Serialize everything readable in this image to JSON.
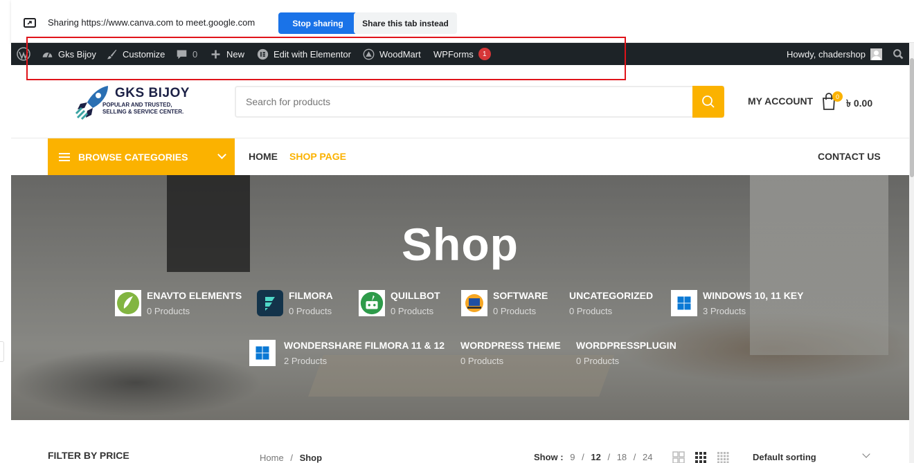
{
  "share_bar": {
    "text": "Sharing https://www.canva.com to meet.google.com",
    "stop_label": "Stop sharing",
    "share_tab_label": "Share this tab instead"
  },
  "admin_bar": {
    "site_name": "Gks Bijoy",
    "customize": "Customize",
    "comments_count": "0",
    "new": "New",
    "elementor": "Edit with Elementor",
    "woodmart": "WoodMart",
    "wpforms": "WPForms",
    "wpforms_badge": "1",
    "howdy": "Howdy, chadershop"
  },
  "header": {
    "logo_title": "GKS BIJOY",
    "logo_sub1": "POPULAR AND TRUSTED,",
    "logo_sub2": "SELLING & SERVICE CENTER.",
    "search_placeholder": "Search for products",
    "my_account": "MY ACCOUNT",
    "cart_count": "0",
    "cart_total": "৳ 0.00"
  },
  "nav": {
    "browse": "BROWSE CATEGORIES",
    "home": "HOME",
    "shop": "SHOP PAGE",
    "contact": "CONTACT US"
  },
  "hero": {
    "title": "Shop",
    "categories": [
      {
        "name": "ENAVTO ELEMENTS",
        "count": "0 Products",
        "icon": "envato-leaf-icon"
      },
      {
        "name": "FILMORA",
        "count": "0 Products",
        "icon": "filmora-icon"
      },
      {
        "name": "QUILLBOT",
        "count": "0 Products",
        "icon": "quillbot-icon"
      },
      {
        "name": "SOFTWARE",
        "count": "0 Products",
        "icon": "software-icon"
      },
      {
        "name": "UNCATEGORIZED",
        "count": "0 Products",
        "icon": ""
      },
      {
        "name": "WINDOWS 10, 11 KEY",
        "count": "3 Products",
        "icon": "windows-icon"
      },
      {
        "name": "WONDERSHARE FILMORA 11 & 12",
        "count": "2 Products",
        "icon": "windows-icon"
      },
      {
        "name": "WORDPRESS THEME",
        "count": "0 Products",
        "icon": ""
      },
      {
        "name": "WORDPRESSPLUGIN",
        "count": "0 Products",
        "icon": ""
      }
    ]
  },
  "toolbar": {
    "filter_title": "FILTER BY PRICE",
    "breadcrumb_home": "Home",
    "breadcrumb_sep": "/",
    "breadcrumb_current": "Shop",
    "show_label": "Show :",
    "show_options": [
      "9",
      "12",
      "18",
      "24"
    ],
    "show_selected": "12",
    "sorting": "Default sorting"
  },
  "colors": {
    "accent": "#fbb200",
    "admin_bar": "#1d2327",
    "share_blue": "#1a73e8",
    "highlight": "#e0131a"
  }
}
